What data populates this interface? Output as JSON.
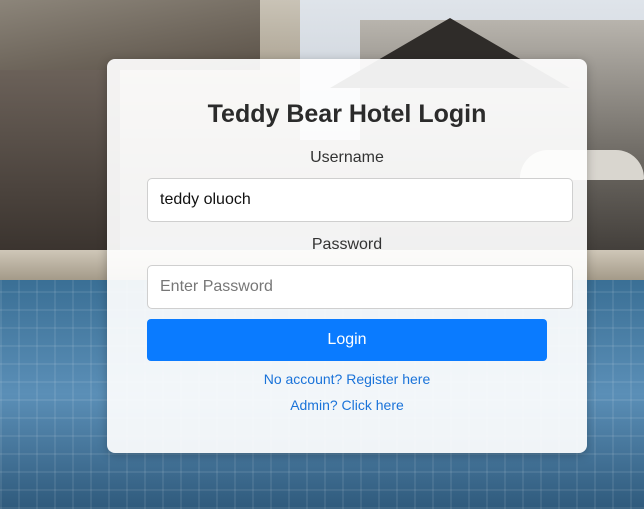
{
  "login": {
    "title": "Teddy Bear Hotel Login",
    "username_label": "Username",
    "username_value": "teddy oluoch",
    "password_label": "Password",
    "password_placeholder": "Enter Password",
    "login_button": "Login",
    "register_link": "No account? Register here",
    "admin_link": "Admin? Click here"
  },
  "colors": {
    "accent": "#0a7bff",
    "link": "#1a73d9"
  }
}
